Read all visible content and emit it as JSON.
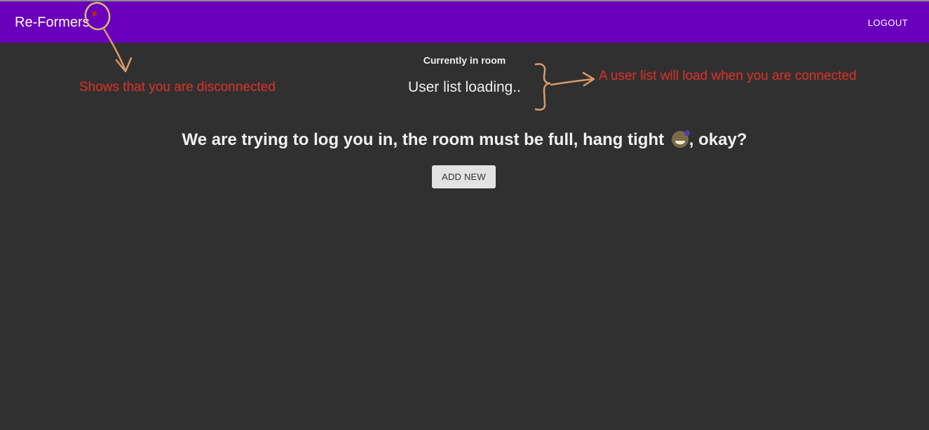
{
  "appbar": {
    "brand": "Re-Formers",
    "logout_label": "LOGOUT",
    "background_color": "#6a00bb",
    "status_dot_color": "#b3261e"
  },
  "room": {
    "heading": "Currently in room",
    "user_list_status": "User list loading.."
  },
  "main": {
    "message_before_emoji": "We are trying to log you in, the room must be full, hang tight ",
    "emoji_name": "grinning-face-emoji",
    "message_after_emoji": ", okay?",
    "add_button_label": "ADD NEW"
  },
  "annotations": {
    "disconnected_note": "Shows that you are disconnected",
    "user_list_note": "A user list will load when you are connected",
    "color": "#c0322b",
    "arrow_color": "#d89a6a"
  },
  "theme": {
    "page_background": "#303030"
  }
}
